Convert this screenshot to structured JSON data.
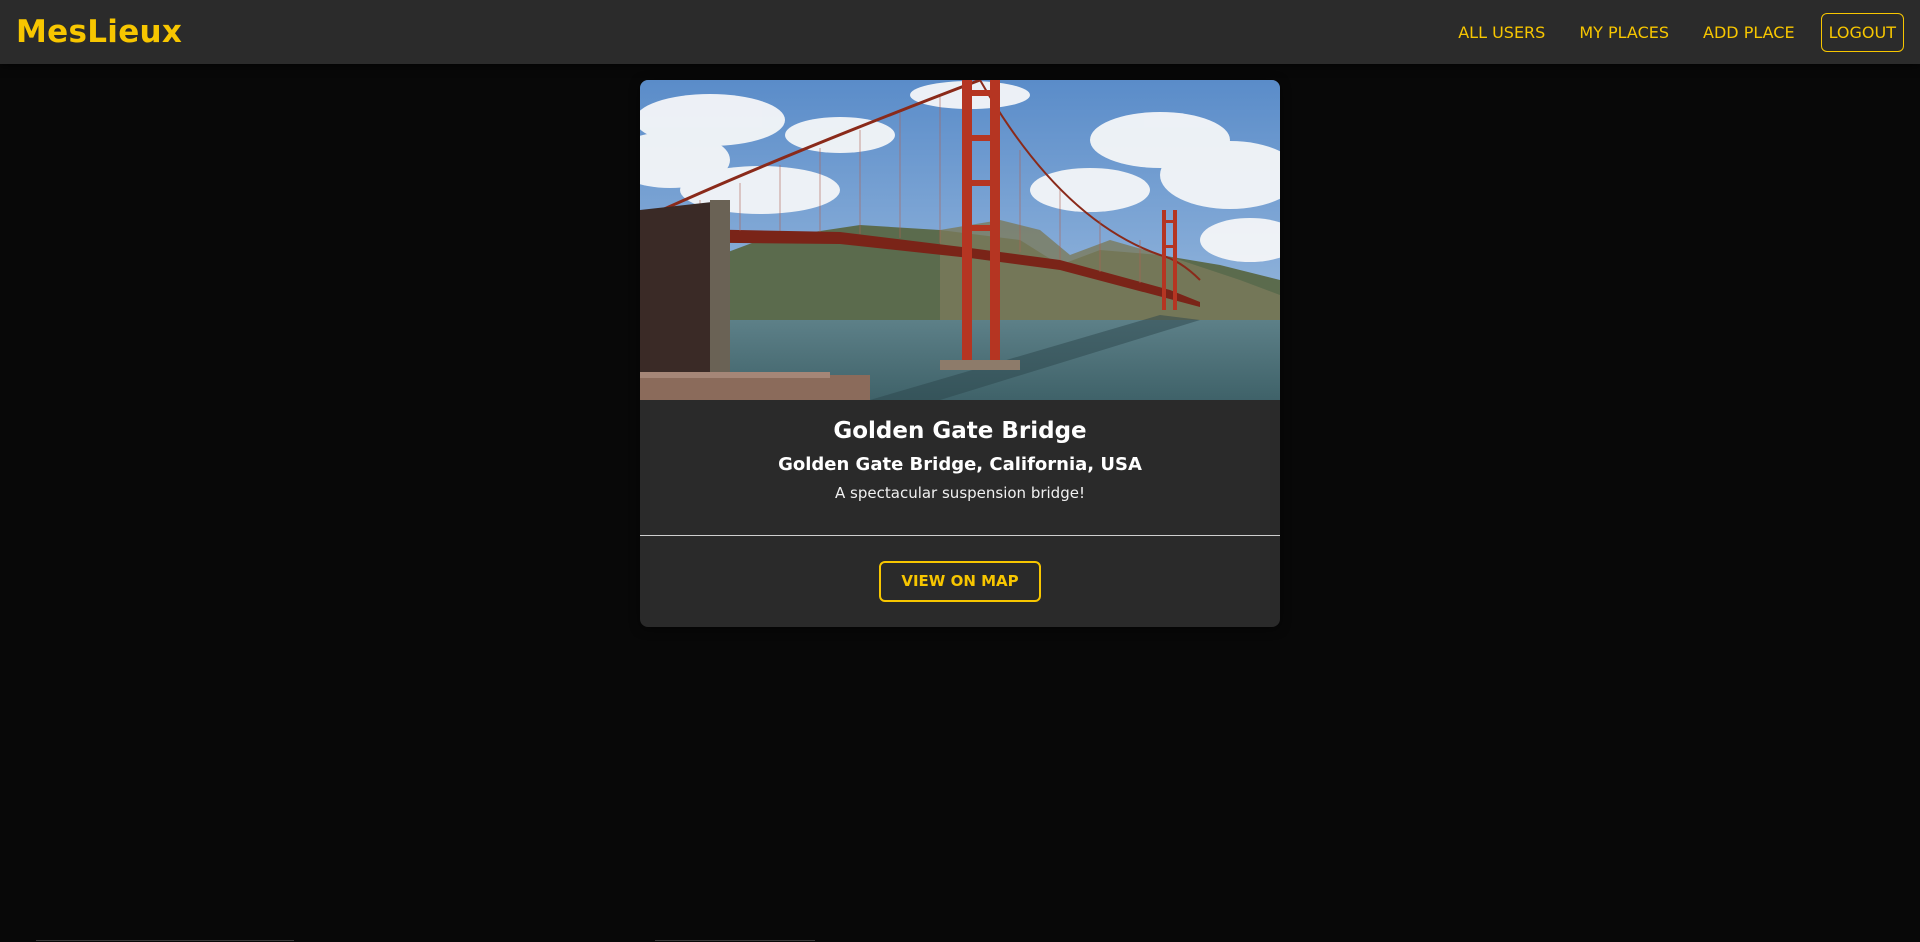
{
  "header": {
    "brand": "MesLieux",
    "nav": {
      "all_users": "ALL USERS",
      "my_places": "MY PLACES",
      "add_place": "ADD PLACE",
      "logout": "LOGOUT"
    }
  },
  "place": {
    "image_icon": "golden-gate-bridge-photo",
    "title": "Golden Gate Bridge",
    "address": "Golden Gate Bridge, California, USA",
    "description": "A spectacular suspension bridge!",
    "view_on_map": "VIEW ON MAP"
  },
  "colors": {
    "accent": "#f7c600",
    "background": "#080808",
    "surface": "#2a2a2a"
  }
}
